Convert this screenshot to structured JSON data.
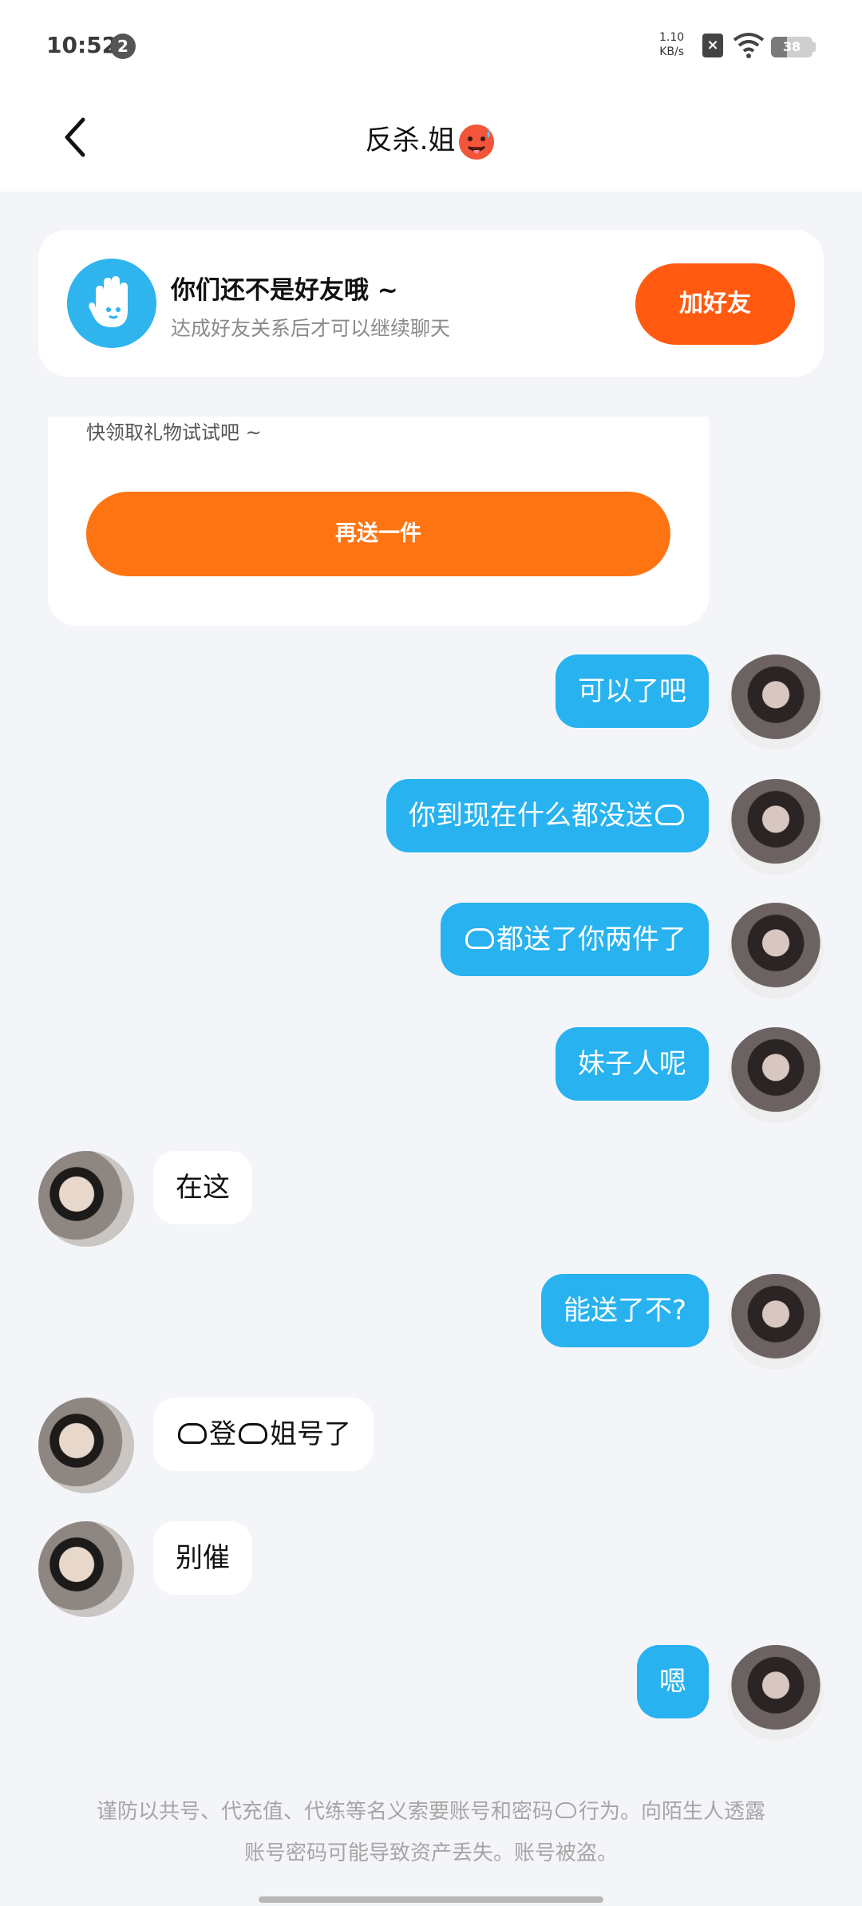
{
  "status_bar": {
    "time": "10:52",
    "notification_count": "2",
    "net_speed_value": "1.10",
    "net_speed_unit": "KB/s",
    "battery": "38",
    "battery_level": 0.38
  },
  "header": {
    "title": "反杀.姐",
    "title_emoji": "hot-face-emoji"
  },
  "friend_banner": {
    "title": "你们还不是好友哦 ~",
    "subtitle": "达成好友关系后才可以继续聊天",
    "button": "加好友"
  },
  "gift_card": {
    "text": "快领取礼物试试吧 ~",
    "button": "再送一件"
  },
  "messages": [
    {
      "side": "out",
      "text": "可以了吧"
    },
    {
      "side": "out",
      "text": "你到现在什么都没送"
    },
    {
      "side": "out",
      "text": "都送了你两件了"
    },
    {
      "side": "out",
      "text": "妹子人呢"
    },
    {
      "side": "in",
      "text": "在这"
    },
    {
      "side": "out",
      "text": "能送了不?"
    },
    {
      "side": "in",
      "text_a": "登",
      "text_b": "姐号了"
    },
    {
      "side": "in",
      "text": "别催"
    },
    {
      "side": "out",
      "text": "嗯"
    }
  ],
  "footer": {
    "line1": "谨防以共号、代充值、代练等名义索要账号和密码",
    "line1_end": "行为。向陌生人透露",
    "line2": "账号密码可能导致资产丢失。账号被盗。"
  },
  "colors": {
    "outgoing_bubble": "#28b2f0",
    "incoming_bubble": "#ffffff",
    "accent_orange": "#ff5a10",
    "gift_orange": "#ff7412",
    "background": "#f4f5f8"
  }
}
